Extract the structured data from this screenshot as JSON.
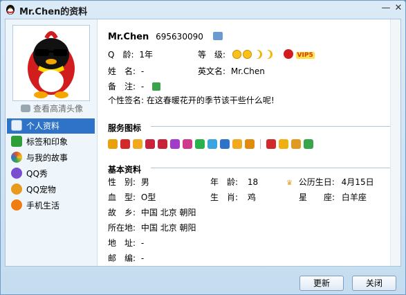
{
  "window": {
    "title": "Mr.Chen的资料",
    "minimize": "—",
    "close": "✕"
  },
  "sidebar": {
    "hd_avatar_label": "查看高清头像",
    "items": [
      {
        "label": "个人资料",
        "color": "#4a7fc1"
      },
      {
        "label": "标签和印象",
        "color": "#2f9e3a"
      },
      {
        "label": "与我的故事",
        "color": "#e2542a"
      },
      {
        "label": "QQ秀",
        "color": "#7a4ed1"
      },
      {
        "label": "QQ宠物",
        "color": "#e89a1c"
      },
      {
        "label": "手机生活",
        "color": "#f07c12"
      }
    ]
  },
  "profile": {
    "nickname": "Mr.Chen",
    "qq_number": "695630090",
    "age_label": "Q　龄:",
    "age_value": "1年",
    "level_label": "等　级:",
    "vip_badge": "VIP5",
    "name_label": "姓　名:",
    "name_value": "-",
    "english_name_label": "英文名:",
    "english_name_value": "Mr.Chen",
    "remark_label": "备　注:",
    "remark_value": "-",
    "signature_label": "个性签名:",
    "signature_value": "在这春暖花开的季节该干些什么呢!"
  },
  "services": {
    "title": "服务图标",
    "icon_colors": [
      "#e8a10b",
      "#d02a2a",
      "#f0a820",
      "#c8233d",
      "#c8233d",
      "#a03cc8",
      "#d03a8a",
      "#2ab04c",
      "#3aa4e0",
      "#2f73c8",
      "#f0a820",
      "#e08a10"
    ],
    "icon_colors_2": [
      "#d02a2a",
      "#f0b010",
      "#e09a20",
      "#3aa44c"
    ]
  },
  "basic": {
    "title": "基本资料",
    "gender_label": "性　别:",
    "gender_value": "男",
    "age_label": "年　龄:",
    "age_value": "18",
    "birthday_label": "公历生日:",
    "birthday_value": "4月15日",
    "blood_label": "血　型:",
    "blood_value": "O型",
    "zodiac_label": "生　肖:",
    "zodiac_value": "鸡",
    "constellation_label": "星　　座:",
    "constellation_value": "白羊座",
    "hometown_label": "故　乡:",
    "hometown_value": "中国 北京 朝阳",
    "location_label": "所在地:",
    "location_value": "中国 北京 朝阳",
    "address_label": "地　址:",
    "address_value": "-",
    "postcode_label": "邮　编:",
    "postcode_value": "-"
  },
  "buttons": {
    "refresh": "更新",
    "close": "关闭"
  }
}
